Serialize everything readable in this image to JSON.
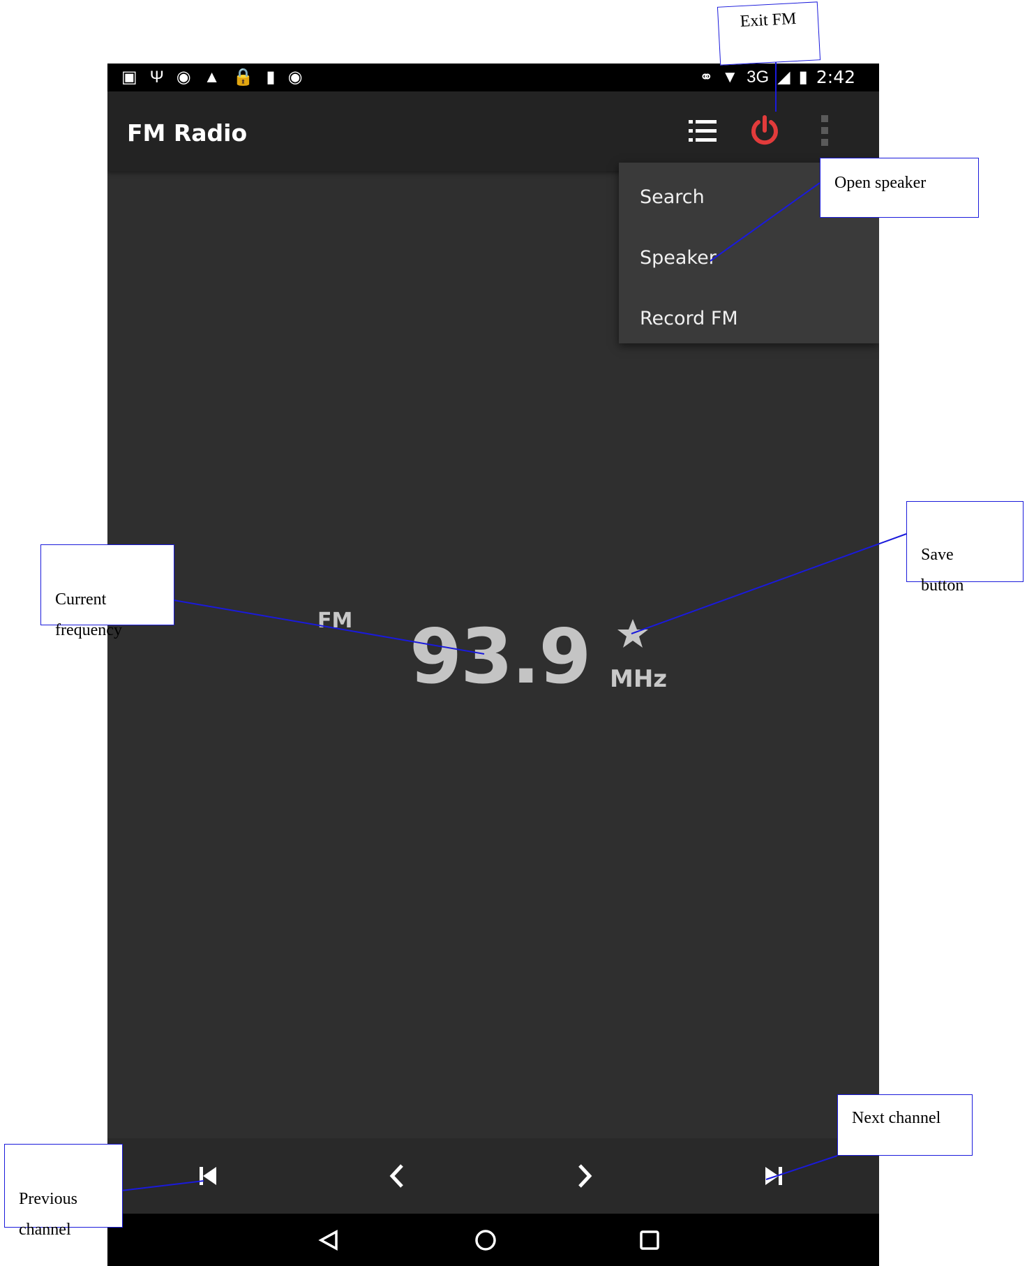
{
  "status_bar": {
    "left_icons": [
      "photo-icon",
      "usb-icon",
      "circle-icon",
      "warning-icon",
      "lock-icon",
      "sd-card-icon",
      "android-icon"
    ],
    "network": "3G",
    "time": "2:42"
  },
  "app_bar": {
    "title": "FM Radio",
    "list_icon": "list-icon",
    "power_icon": "power-icon",
    "overflow_icon": "overflow-menu-icon",
    "power_color": "#e23b3b"
  },
  "overflow_menu": {
    "items": [
      {
        "label": "Search"
      },
      {
        "label": "Speaker"
      },
      {
        "label": "Record FM"
      }
    ]
  },
  "tuner": {
    "band": "FM",
    "frequency": "93.9",
    "unit": "MHz",
    "favorite_icon": "star-icon"
  },
  "controls": {
    "icons": [
      "skip-previous-icon",
      "chevron-left-icon",
      "chevron-right-icon",
      "skip-next-icon"
    ]
  },
  "nav_bar": {
    "icons": [
      "back-icon",
      "home-icon",
      "recents-icon"
    ]
  },
  "annotations": [
    {
      "id": "exit",
      "text": "Exit FM"
    },
    {
      "id": "speaker",
      "text": "Open speaker"
    },
    {
      "id": "save",
      "text": "Save\nbutton"
    },
    {
      "id": "current",
      "text": "Current\nfrequency"
    },
    {
      "id": "next",
      "text": "Next channel"
    },
    {
      "id": "previous",
      "text": "Previous\nchannel"
    }
  ]
}
